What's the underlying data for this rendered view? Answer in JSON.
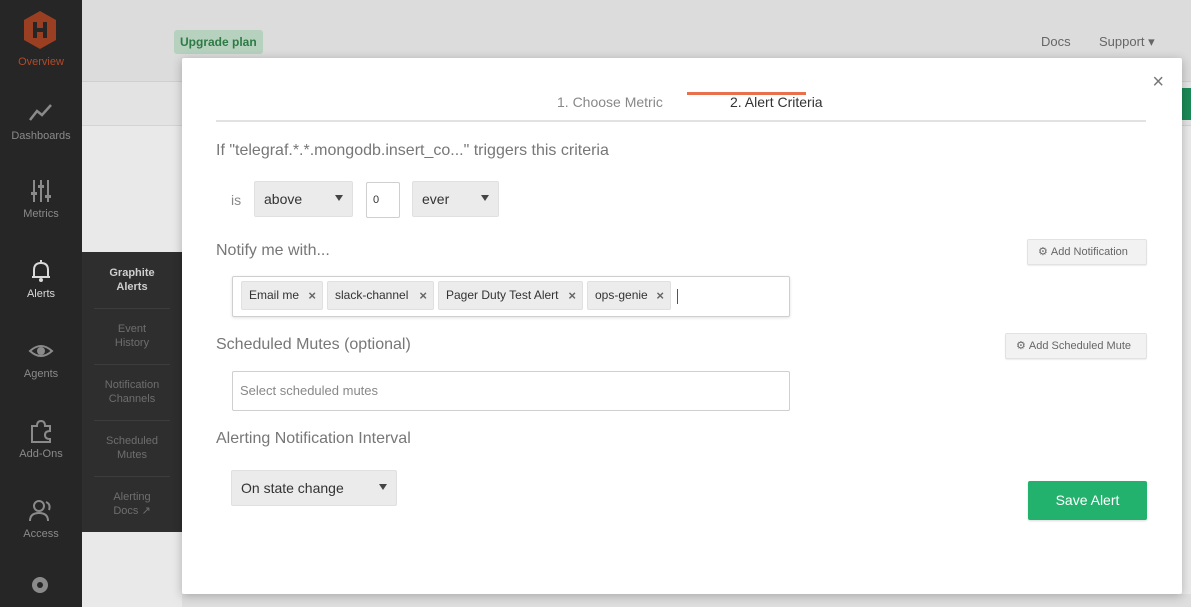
{
  "sidebar": {
    "items": [
      {
        "label": "Overview",
        "icon": "logo-hexagon-icon"
      },
      {
        "label": "Dashboards",
        "icon": "line-chart-icon"
      },
      {
        "label": "Metrics",
        "icon": "sliders-icon"
      },
      {
        "label": "Alerts",
        "icon": "bell-icon"
      },
      {
        "label": "Agents",
        "icon": "eye-icon"
      },
      {
        "label": "Add-Ons",
        "icon": "puzzle-icon"
      },
      {
        "label": "Access",
        "icon": "users-icon"
      }
    ]
  },
  "subnav": {
    "items": [
      {
        "line1": "Graphite",
        "line2": "Alerts"
      },
      {
        "line1": "Event",
        "line2": "History"
      },
      {
        "line1": "Notification",
        "line2": "Channels"
      },
      {
        "line1": "Scheduled",
        "line2": "Mutes"
      },
      {
        "line1": "Alerting",
        "line2": "Docs ↗"
      }
    ]
  },
  "topbar": {
    "upgrade_label": "Upgrade plan",
    "docs_label": "Docs",
    "support_label": "Support ▾"
  },
  "modal": {
    "close_label": "×",
    "tabs": [
      {
        "label": "1. Choose Metric"
      },
      {
        "label": "2. Alert Criteria"
      }
    ],
    "criteria_title": "If \"telegraf.*.*.mongodb.insert_co...\" triggers this criteria",
    "criteria": {
      "is_label": "is",
      "comparison": "above",
      "threshold": "0",
      "duration": "ever"
    },
    "notify_title": "Notify me with...",
    "add_notification_label": "Add Notification",
    "notifications": [
      "Email me",
      "slack-channel",
      "Pager Duty Test Alert",
      "ops-genie"
    ],
    "tag_remove_label": "×",
    "mutes_title": "Scheduled Mutes (optional)",
    "add_mute_label": "Add Scheduled Mute",
    "mutes_placeholder": "Select scheduled mutes",
    "interval_title": "Alerting Notification Interval",
    "interval_value": "On state change",
    "save_label": "Save Alert"
  },
  "colors": {
    "accent_orange": "#e8714c",
    "save_green": "#23b26d",
    "sidebar_bg": "#262626"
  }
}
